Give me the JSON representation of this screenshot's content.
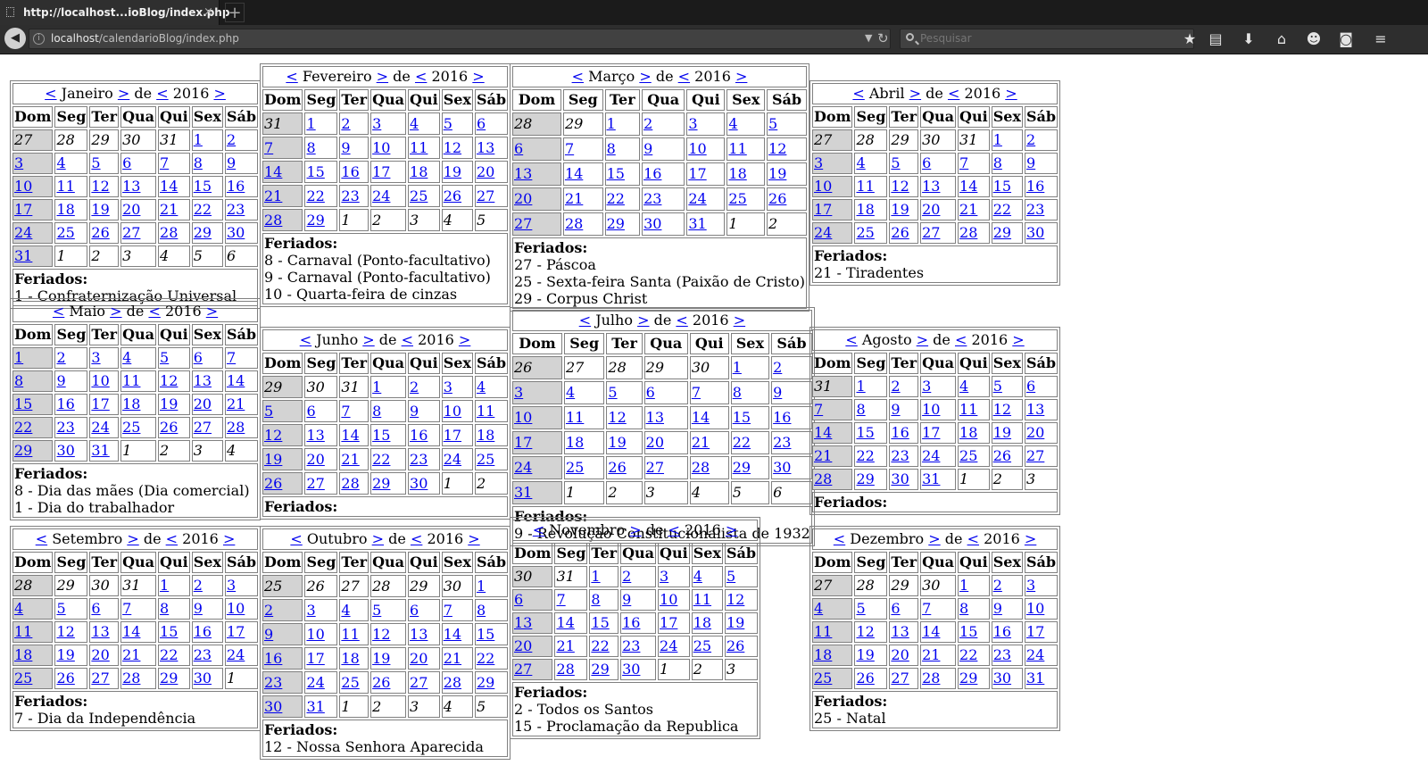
{
  "browser": {
    "tab_title": "http://localhost...ioBlog/index.php",
    "tab_close": "×",
    "new_tab": "+",
    "url_host": "localhost",
    "url_path": "/calendarioBlog/index.php",
    "search_placeholder": "Pesquisar"
  },
  "calendar": {
    "year": "2016",
    "prev": "<",
    "next": ">",
    "de": "de",
    "weekdays": [
      "Dom",
      "Seg",
      "Ter",
      "Qua",
      "Qui",
      "Sex",
      "Sáb"
    ],
    "feriados_label": "Feriados:",
    "months": [
      {
        "name": "Janeiro",
        "lead": [
          27,
          28,
          29,
          30,
          31
        ],
        "days": 31,
        "holidays": [
          "1 - Confraternização Universal"
        ]
      },
      {
        "name": "Fevereiro",
        "lead": [
          31
        ],
        "days": 29,
        "holidays": [
          "8 - Carnaval (Ponto-facultativo)",
          "9 - Carnaval (Ponto-facultativo)",
          "10 - Quarta-feira de cinzas"
        ]
      },
      {
        "name": "Março",
        "lead": [
          28,
          29
        ],
        "days": 31,
        "holidays": [
          "27 - Páscoa",
          "25 - Sexta-feira Santa (Paixão de Cristo)",
          "29 - Corpus Christ"
        ]
      },
      {
        "name": "Abril",
        "lead": [
          27,
          28,
          29,
          30,
          31
        ],
        "days": 30,
        "holidays": [
          "21 - Tiradentes"
        ]
      },
      {
        "name": "Maio",
        "lead": [],
        "days": 31,
        "holidays": [
          "8 - Dia das mães (Dia comercial)",
          "1 - Dia do trabalhador"
        ]
      },
      {
        "name": "Junho",
        "lead": [
          29,
          30,
          31
        ],
        "days": 30,
        "holidays": []
      },
      {
        "name": "Julho",
        "lead": [
          26,
          27,
          28,
          29,
          30
        ],
        "days": 31,
        "holidays": [
          "9 - Revolução Constitucionalista de 1932"
        ]
      },
      {
        "name": "Agosto",
        "lead": [
          31
        ],
        "days": 31,
        "holidays": []
      },
      {
        "name": "Setembro",
        "lead": [
          28,
          29,
          30,
          31
        ],
        "days": 30,
        "holidays": [
          "7 - Dia da Independência"
        ]
      },
      {
        "name": "Outubro",
        "lead": [
          25,
          26,
          27,
          28,
          29,
          30
        ],
        "days": 31,
        "holidays": [
          "12 - Nossa Senhora Aparecida"
        ]
      },
      {
        "name": "Novembro",
        "lead": [
          30,
          31
        ],
        "days": 30,
        "holidays": [
          "2 - Todos os Santos",
          "15 - Proclamação da Republica"
        ]
      },
      {
        "name": "Dezembro",
        "lead": [
          27,
          28,
          29,
          30
        ],
        "days": 31,
        "holidays": [
          "25 - Natal"
        ]
      }
    ]
  }
}
